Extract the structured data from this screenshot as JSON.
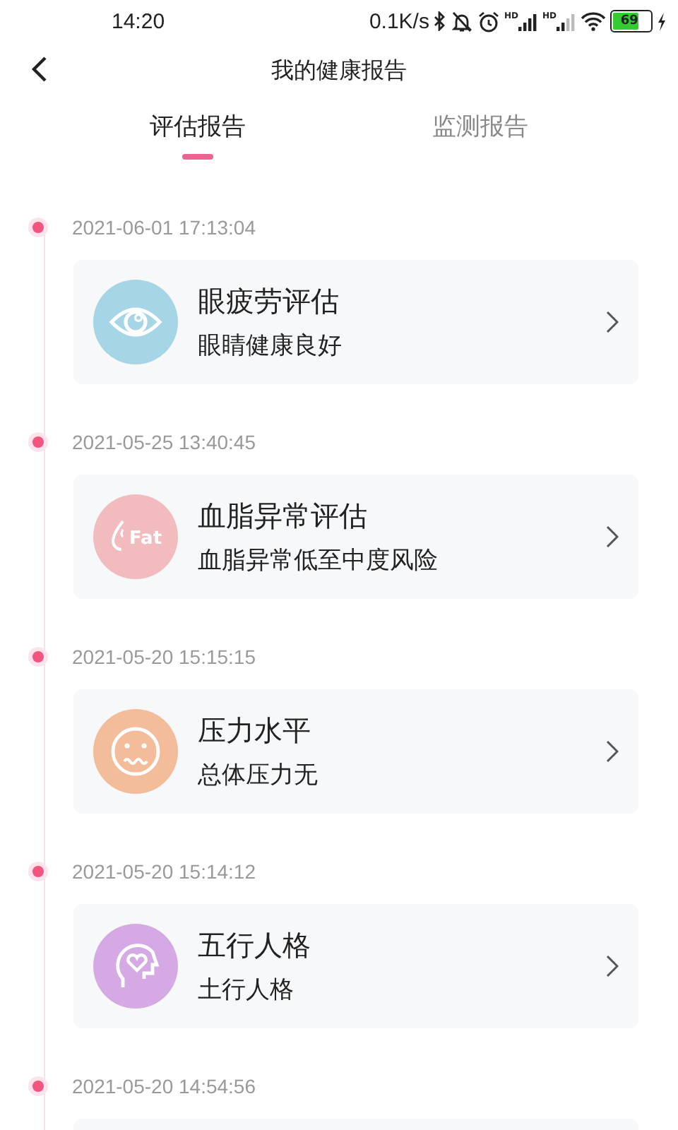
{
  "status_bar": {
    "time": "14:20",
    "net_speed": "0.1K/s",
    "signal_labels": [
      "HD",
      "HD"
    ],
    "battery": "69",
    "charging": true
  },
  "header": {
    "title": "我的健康报告"
  },
  "tabs": [
    {
      "label": "评估报告",
      "selected": true
    },
    {
      "label": "监测报告",
      "selected": false
    }
  ],
  "reports": [
    {
      "date": "2021-06-01 17:13:04",
      "kind": "eye",
      "color": "#a6d5e6",
      "title": "眼疲劳评估",
      "result": "眼睛健康良好"
    },
    {
      "date": "2021-05-25 13:40:45",
      "kind": "fat",
      "color": "#f2bcbe",
      "icon_label": "Fat",
      "title": "血脂异常评估",
      "result": "血脂异常低至中度风险"
    },
    {
      "date": "2021-05-20 15:15:15",
      "kind": "stress",
      "color": "#f3bd9b",
      "title": "压力水平",
      "result": "总体压力无"
    },
    {
      "date": "2021-05-20 15:14:12",
      "kind": "personality",
      "color": "#d5a9e3",
      "title": "五行人格",
      "result": "土行人格"
    },
    {
      "date": "2021-05-20 14:54:56"
    }
  ]
}
